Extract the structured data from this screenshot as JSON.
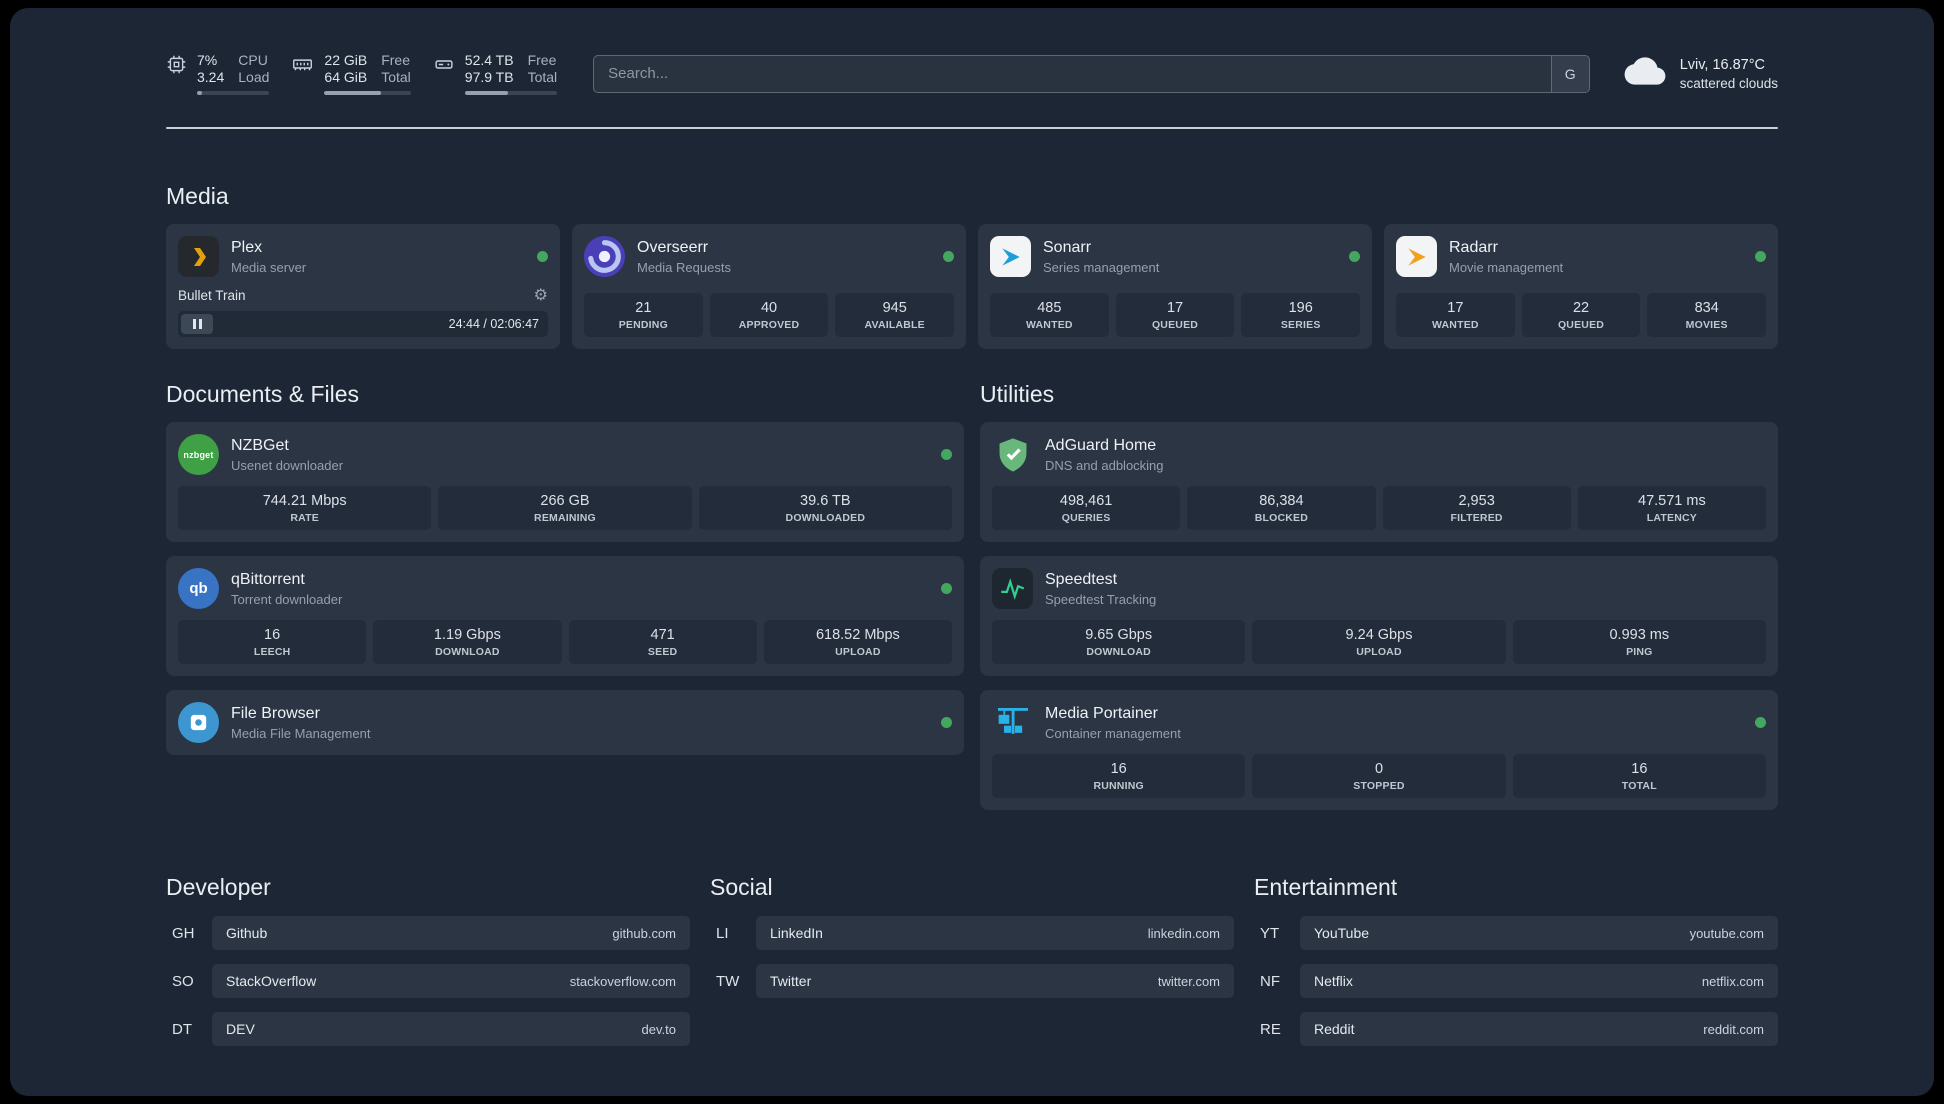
{
  "colors": {
    "background": "#1c2634",
    "card": "#2b3544",
    "stat_box": "#232c3a",
    "status_online": "#41a85e",
    "plex_accent": "#e5a00d",
    "divider": "#dde3e9"
  },
  "topbar": {
    "resources": [
      {
        "icon": "cpu-icon",
        "value_top": "7%",
        "label_top": "CPU",
        "value_bottom": "3.24",
        "label_bottom": "Load",
        "progress": 7
      },
      {
        "icon": "ram-icon",
        "value_top": "22 GiB",
        "label_top": "Free",
        "value_bottom": "64 GiB",
        "label_bottom": "Total",
        "progress": 66
      },
      {
        "icon": "disk-icon",
        "value_top": "52.4 TB",
        "label_top": "Free",
        "value_bottom": "97.9 TB",
        "label_bottom": "Total",
        "progress": 47
      }
    ],
    "search": {
      "placeholder": "Search...",
      "provider_button": "G"
    },
    "weather": {
      "location": "Lviv, 16.87°C",
      "condition": "scattered clouds"
    }
  },
  "sections": {
    "media": {
      "title": "Media",
      "plex": {
        "name": "Plex",
        "desc": "Media server",
        "status": "online",
        "player": {
          "track": "Bullet Train",
          "time": "24:44 / 02:06:47"
        }
      },
      "overseerr": {
        "name": "Overseerr",
        "desc": "Media Requests",
        "status": "online",
        "stats": [
          {
            "value": "21",
            "label": "PENDING"
          },
          {
            "value": "40",
            "label": "APPROVED"
          },
          {
            "value": "945",
            "label": "AVAILABLE"
          }
        ]
      },
      "sonarr": {
        "name": "Sonarr",
        "desc": "Series management",
        "status": "online",
        "stats": [
          {
            "value": "485",
            "label": "WANTED"
          },
          {
            "value": "17",
            "label": "QUEUED"
          },
          {
            "value": "196",
            "label": "SERIES"
          }
        ]
      },
      "radarr": {
        "name": "Radarr",
        "desc": "Movie management",
        "status": "online",
        "stats": [
          {
            "value": "17",
            "label": "WANTED"
          },
          {
            "value": "22",
            "label": "QUEUED"
          },
          {
            "value": "834",
            "label": "MOVIES"
          }
        ]
      }
    },
    "documents": {
      "title": "Documents & Files",
      "nzbget": {
        "name": "NZBGet",
        "desc": "Usenet downloader",
        "status": "online",
        "icon_text": "nzbget",
        "stats": [
          {
            "value": "744.21 Mbps",
            "label": "RATE"
          },
          {
            "value": "266 GB",
            "label": "REMAINING"
          },
          {
            "value": "39.6 TB",
            "label": "DOWNLOADED"
          }
        ]
      },
      "qbittorrent": {
        "name": "qBittorrent",
        "desc": "Torrent downloader",
        "status": "online",
        "icon_text": "qb",
        "stats": [
          {
            "value": "16",
            "label": "LEECH"
          },
          {
            "value": "1.19 Gbps",
            "label": "DOWNLOAD"
          },
          {
            "value": "471",
            "label": "SEED"
          },
          {
            "value": "618.52 Mbps",
            "label": "UPLOAD"
          }
        ]
      },
      "filebrowser": {
        "name": "File Browser",
        "desc": "Media File Management",
        "status": "online"
      }
    },
    "utilities": {
      "title": "Utilities",
      "adguard": {
        "name": "AdGuard Home",
        "desc": "DNS and adblocking",
        "stats": [
          {
            "value": "498,461",
            "label": "QUERIES"
          },
          {
            "value": "86,384",
            "label": "BLOCKED"
          },
          {
            "value": "2,953",
            "label": "FILTERED"
          },
          {
            "value": "47.571 ms",
            "label": "LATENCY"
          }
        ]
      },
      "speedtest": {
        "name": "Speedtest",
        "desc": "Speedtest Tracking",
        "stats": [
          {
            "value": "9.65 Gbps",
            "label": "DOWNLOAD"
          },
          {
            "value": "9.24 Gbps",
            "label": "UPLOAD"
          },
          {
            "value": "0.993 ms",
            "label": "PING"
          }
        ]
      },
      "portainer": {
        "name": "Media Portainer",
        "desc": "Container management",
        "status": "online",
        "stats": [
          {
            "value": "16",
            "label": "RUNNING"
          },
          {
            "value": "0",
            "label": "STOPPED"
          },
          {
            "value": "16",
            "label": "TOTAL"
          }
        ]
      }
    }
  },
  "bookmarks": {
    "developer": {
      "title": "Developer",
      "items": [
        {
          "abbr": "GH",
          "name": "Github",
          "url": "github.com"
        },
        {
          "abbr": "SO",
          "name": "StackOverflow",
          "url": "stackoverflow.com"
        },
        {
          "abbr": "DT",
          "name": "DEV",
          "url": "dev.to"
        }
      ]
    },
    "social": {
      "title": "Social",
      "items": [
        {
          "abbr": "LI",
          "name": "LinkedIn",
          "url": "linkedin.com"
        },
        {
          "abbr": "TW",
          "name": "Twitter",
          "url": "twitter.com"
        }
      ]
    },
    "entertainment": {
      "title": "Entertainment",
      "items": [
        {
          "abbr": "YT",
          "name": "YouTube",
          "url": "youtube.com"
        },
        {
          "abbr": "NF",
          "name": "Netflix",
          "url": "netflix.com"
        },
        {
          "abbr": "RE",
          "name": "Reddit",
          "url": "reddit.com"
        }
      ]
    }
  }
}
